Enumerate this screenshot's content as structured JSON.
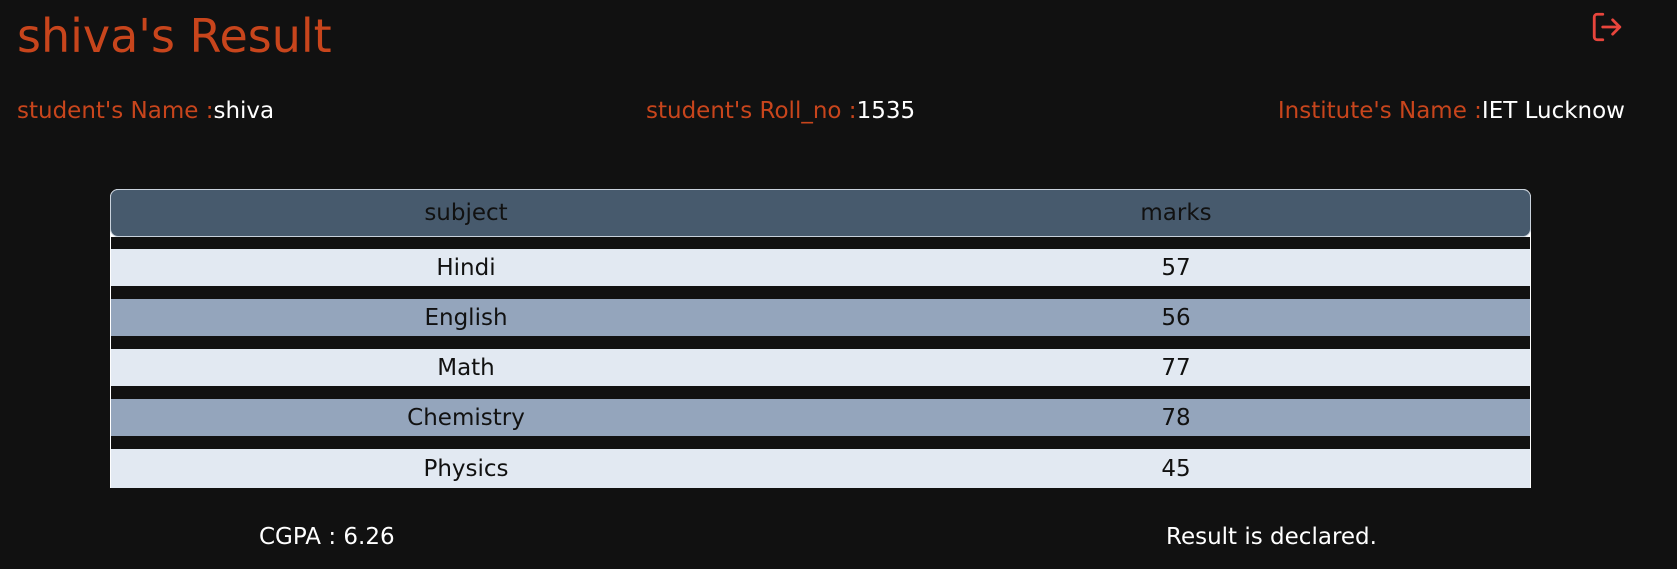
{
  "header": {
    "title": "shiva's Result",
    "logout_icon": "logout-icon",
    "logout_color": "#e8453c"
  },
  "info": {
    "name_label": "student's Name :",
    "name_value": "shiva",
    "roll_label": "student's Roll_no :",
    "roll_value": "1535",
    "institute_label": "Institute's Name :",
    "institute_value": "IET Lucknow"
  },
  "table": {
    "headers": [
      "subject",
      "marks"
    ],
    "rows": [
      {
        "subject": "Hindi",
        "marks": "57"
      },
      {
        "subject": "English",
        "marks": "56"
      },
      {
        "subject": "Math",
        "marks": "77"
      },
      {
        "subject": "Chemistry",
        "marks": "78"
      },
      {
        "subject": "Physics",
        "marks": "45"
      }
    ]
  },
  "footer": {
    "cgpa": "CGPA : 6.26",
    "status": "Result is declared."
  },
  "colors": {
    "accent": "#c8451c",
    "background": "#111111",
    "header_row": "#475a6d",
    "row_light": "#e2e9f2",
    "row_dark": "#94a5bc"
  }
}
